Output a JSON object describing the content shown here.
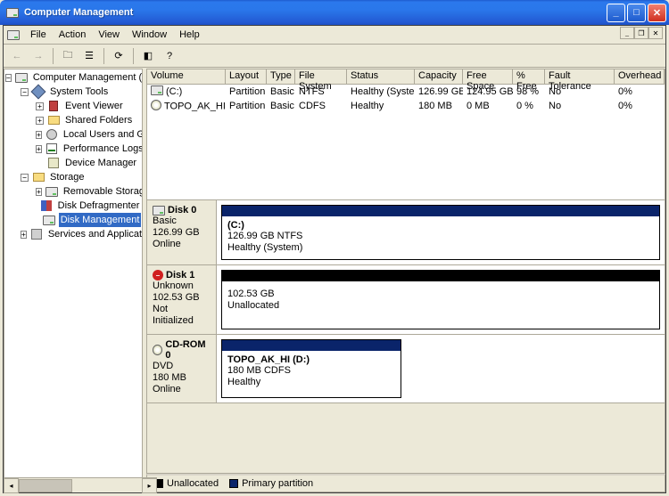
{
  "title": "Computer Management",
  "menus": [
    "File",
    "Action",
    "View",
    "Window",
    "Help"
  ],
  "tree": {
    "root": "Computer Management (Local)",
    "system_tools": "System Tools",
    "event_viewer": "Event Viewer",
    "shared_folders": "Shared Folders",
    "local_users": "Local Users and Groups",
    "perf_logs": "Performance Logs and Alerts",
    "device_mgr": "Device Manager",
    "storage": "Storage",
    "removable": "Removable Storage",
    "defrag": "Disk Defragmenter",
    "diskmgmt": "Disk Management",
    "services": "Services and Applications"
  },
  "cols": {
    "volume": "Volume",
    "layout": "Layout",
    "type": "Type",
    "fs": "File System",
    "status": "Status",
    "capacity": "Capacity",
    "free": "Free Space",
    "pct": "% Free",
    "fault": "Fault Tolerance",
    "overhead": "Overhead"
  },
  "volumes": [
    {
      "vol": "(C:)",
      "layout": "Partition",
      "type": "Basic",
      "fs": "NTFS",
      "status": "Healthy (System)",
      "cap": "126.99 GB",
      "free": "124.95 GB",
      "pct": "98 %",
      "fault": "No",
      "ov": "0%"
    },
    {
      "vol": "TOPO_AK_HI (D:)",
      "layout": "Partition",
      "type": "Basic",
      "fs": "CDFS",
      "status": "Healthy",
      "cap": "180 MB",
      "free": "0 MB",
      "pct": "0 %",
      "fault": "No",
      "ov": "0%"
    }
  ],
  "disks": [
    {
      "name": "Disk 0",
      "kind": "Basic",
      "size": "126.99 GB",
      "state": "Online",
      "parts": [
        {
          "title": "(C:)",
          "sub": "126.99 GB NTFS",
          "stat": "Healthy (System)",
          "style": "primary",
          "width": "100%"
        }
      ],
      "icon": "drive"
    },
    {
      "name": "Disk 1",
      "kind": "Unknown",
      "size": "102.53 GB",
      "state": "Not Initialized",
      "parts": [
        {
          "title": "",
          "sub": "102.53 GB",
          "stat": "Unallocated",
          "style": "unalloc",
          "width": "100%"
        }
      ],
      "icon": "stop"
    },
    {
      "name": "CD-ROM 0",
      "kind": "DVD",
      "size": "180 MB",
      "state": "Online",
      "parts": [
        {
          "title": "TOPO_AK_HI (D:)",
          "sub": "180 MB CDFS",
          "stat": "Healthy",
          "style": "primary",
          "width": "41%"
        }
      ],
      "icon": "cd"
    }
  ],
  "legend": {
    "unalloc": "Unallocated",
    "primary": "Primary partition"
  }
}
